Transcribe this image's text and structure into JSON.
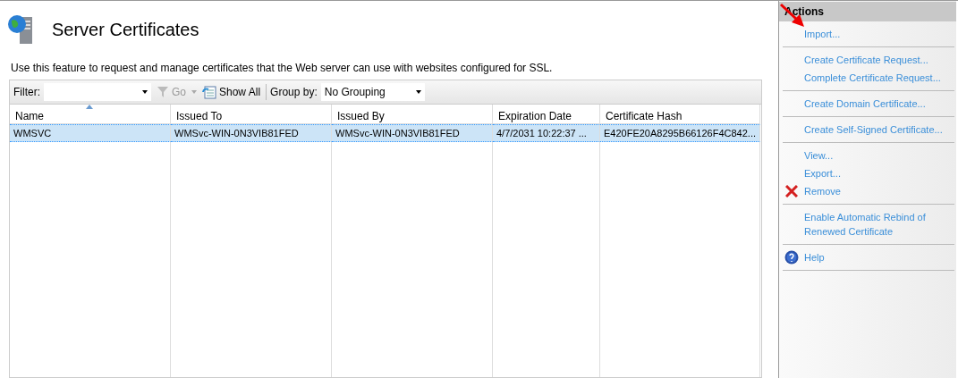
{
  "page": {
    "title": "Server Certificates",
    "description": "Use this feature to request and manage certificates that the Web server can use with websites configured for SSL."
  },
  "toolbar": {
    "filter_label": "Filter:",
    "go": {
      "label": "Go",
      "disabled": true
    },
    "show_all": "Show All",
    "group_by_label": "Group by:",
    "group_by_value": "No Grouping"
  },
  "table": {
    "columns": [
      {
        "label": "Name",
        "sorted": true
      },
      {
        "label": "Issued To",
        "sorted": false
      },
      {
        "label": "Issued By",
        "sorted": false
      },
      {
        "label": "Expiration Date",
        "sorted": false
      },
      {
        "label": "Certificate Hash",
        "sorted": false
      }
    ],
    "rows": [
      {
        "selected": true,
        "cells": [
          "WMSVC",
          "WMSvc-WIN-0N3VIB81FED",
          "WMSvc-WIN-0N3VIB81FED",
          "4/7/2031 10:22:37 ...",
          "E420FE20A8295B66126F4C842..."
        ]
      }
    ]
  },
  "actions": {
    "title": "Actions",
    "groups": [
      [
        {
          "kind": "link",
          "label": "Import..."
        }
      ],
      [
        {
          "kind": "link",
          "label": "Create Certificate Request..."
        },
        {
          "kind": "link",
          "label": "Complete Certificate Request..."
        }
      ],
      [
        {
          "kind": "link",
          "label": "Create Domain Certificate..."
        }
      ],
      [
        {
          "kind": "link",
          "label": "Create Self-Signed Certificate..."
        }
      ],
      [
        {
          "kind": "link",
          "label": "View..."
        },
        {
          "kind": "link",
          "label": "Export..."
        },
        {
          "kind": "remove",
          "label": "Remove"
        }
      ],
      [
        {
          "kind": "link",
          "label": "Enable Automatic Rebind of Renewed Certificate"
        }
      ],
      [
        {
          "kind": "help",
          "label": "Help"
        }
      ]
    ]
  }
}
